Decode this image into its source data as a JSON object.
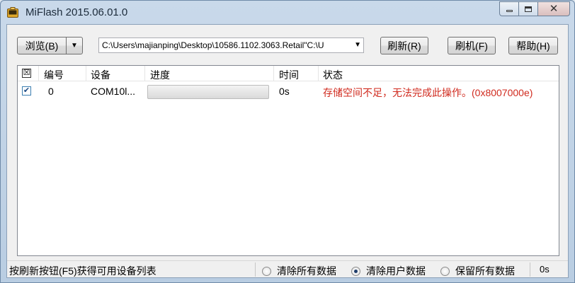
{
  "window": {
    "title": "MiFlash 2015.06.01.0",
    "minimize_label": "minimize",
    "maximize_label": "maximize",
    "close_label": "close"
  },
  "toolbar": {
    "browse_label": "浏览(B)",
    "path_value": "C:\\Users\\majianping\\Desktop\\10586.1102.3063.Retail\"C:\\U",
    "refresh_label": "刷新(R)",
    "flash_label": "刷机(F)",
    "help_label": "帮助(H)"
  },
  "table": {
    "columns": {
      "check": "☒",
      "number": "编号",
      "device": "设备",
      "progress": "进度",
      "time": "时间",
      "status": "状态"
    },
    "rows": [
      {
        "checked": "✔",
        "number": "0",
        "device": "COM10l...",
        "progress_fraction": 0,
        "time": "0s",
        "status": "存储空间不足，无法完成此操作。(0x8007000e)"
      }
    ]
  },
  "statusbar": {
    "hint": "按刷新按钮(F5)获得可用设备列表",
    "options": [
      {
        "label": "清除所有数据",
        "selected": false
      },
      {
        "label": "清除用户数据",
        "selected": true
      },
      {
        "label": "保留所有数据",
        "selected": false
      }
    ],
    "elapsed": "0s"
  },
  "colors": {
    "error_text": "#d02a1e",
    "titlebar": "#c9d9ea"
  }
}
